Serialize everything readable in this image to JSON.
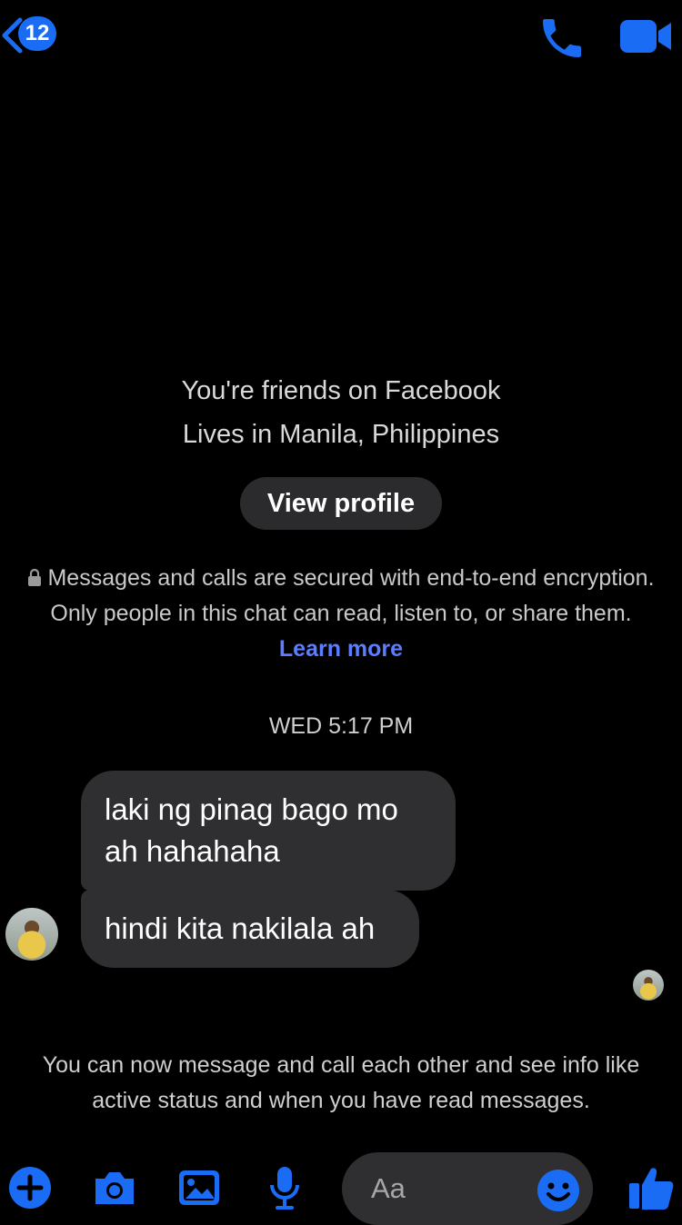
{
  "header": {
    "back_count": "12",
    "call_icon": "phone-icon",
    "video_icon": "video-camera-icon"
  },
  "intro": {
    "friends_text": "You're friends on Facebook",
    "lives_text": "Lives in Manila, Philippines",
    "view_profile_label": "View profile"
  },
  "encryption": {
    "text": "Messages and calls are secured with end-to-end encryption. Only people in this chat can read, listen to, or share them.",
    "learn_more": "Learn more"
  },
  "timestamp": "WED 5:17 PM",
  "messages": [
    {
      "text": "laki ng pinag bago mo ah hahahaha"
    },
    {
      "text": "hindi kita nakilala ah"
    }
  ],
  "notice": "You can now message and call each other and see info like active status and when you have read messages.",
  "composer": {
    "placeholder": "Aa",
    "icons": [
      "plus-icon",
      "camera-icon",
      "gallery-icon",
      "microphone-icon",
      "emoji-icon",
      "thumbs-up-icon"
    ]
  },
  "colors": {
    "accent": "#1a6cf5",
    "link": "#5b7dff",
    "bubble": "#2f2f31",
    "background": "#000000"
  }
}
